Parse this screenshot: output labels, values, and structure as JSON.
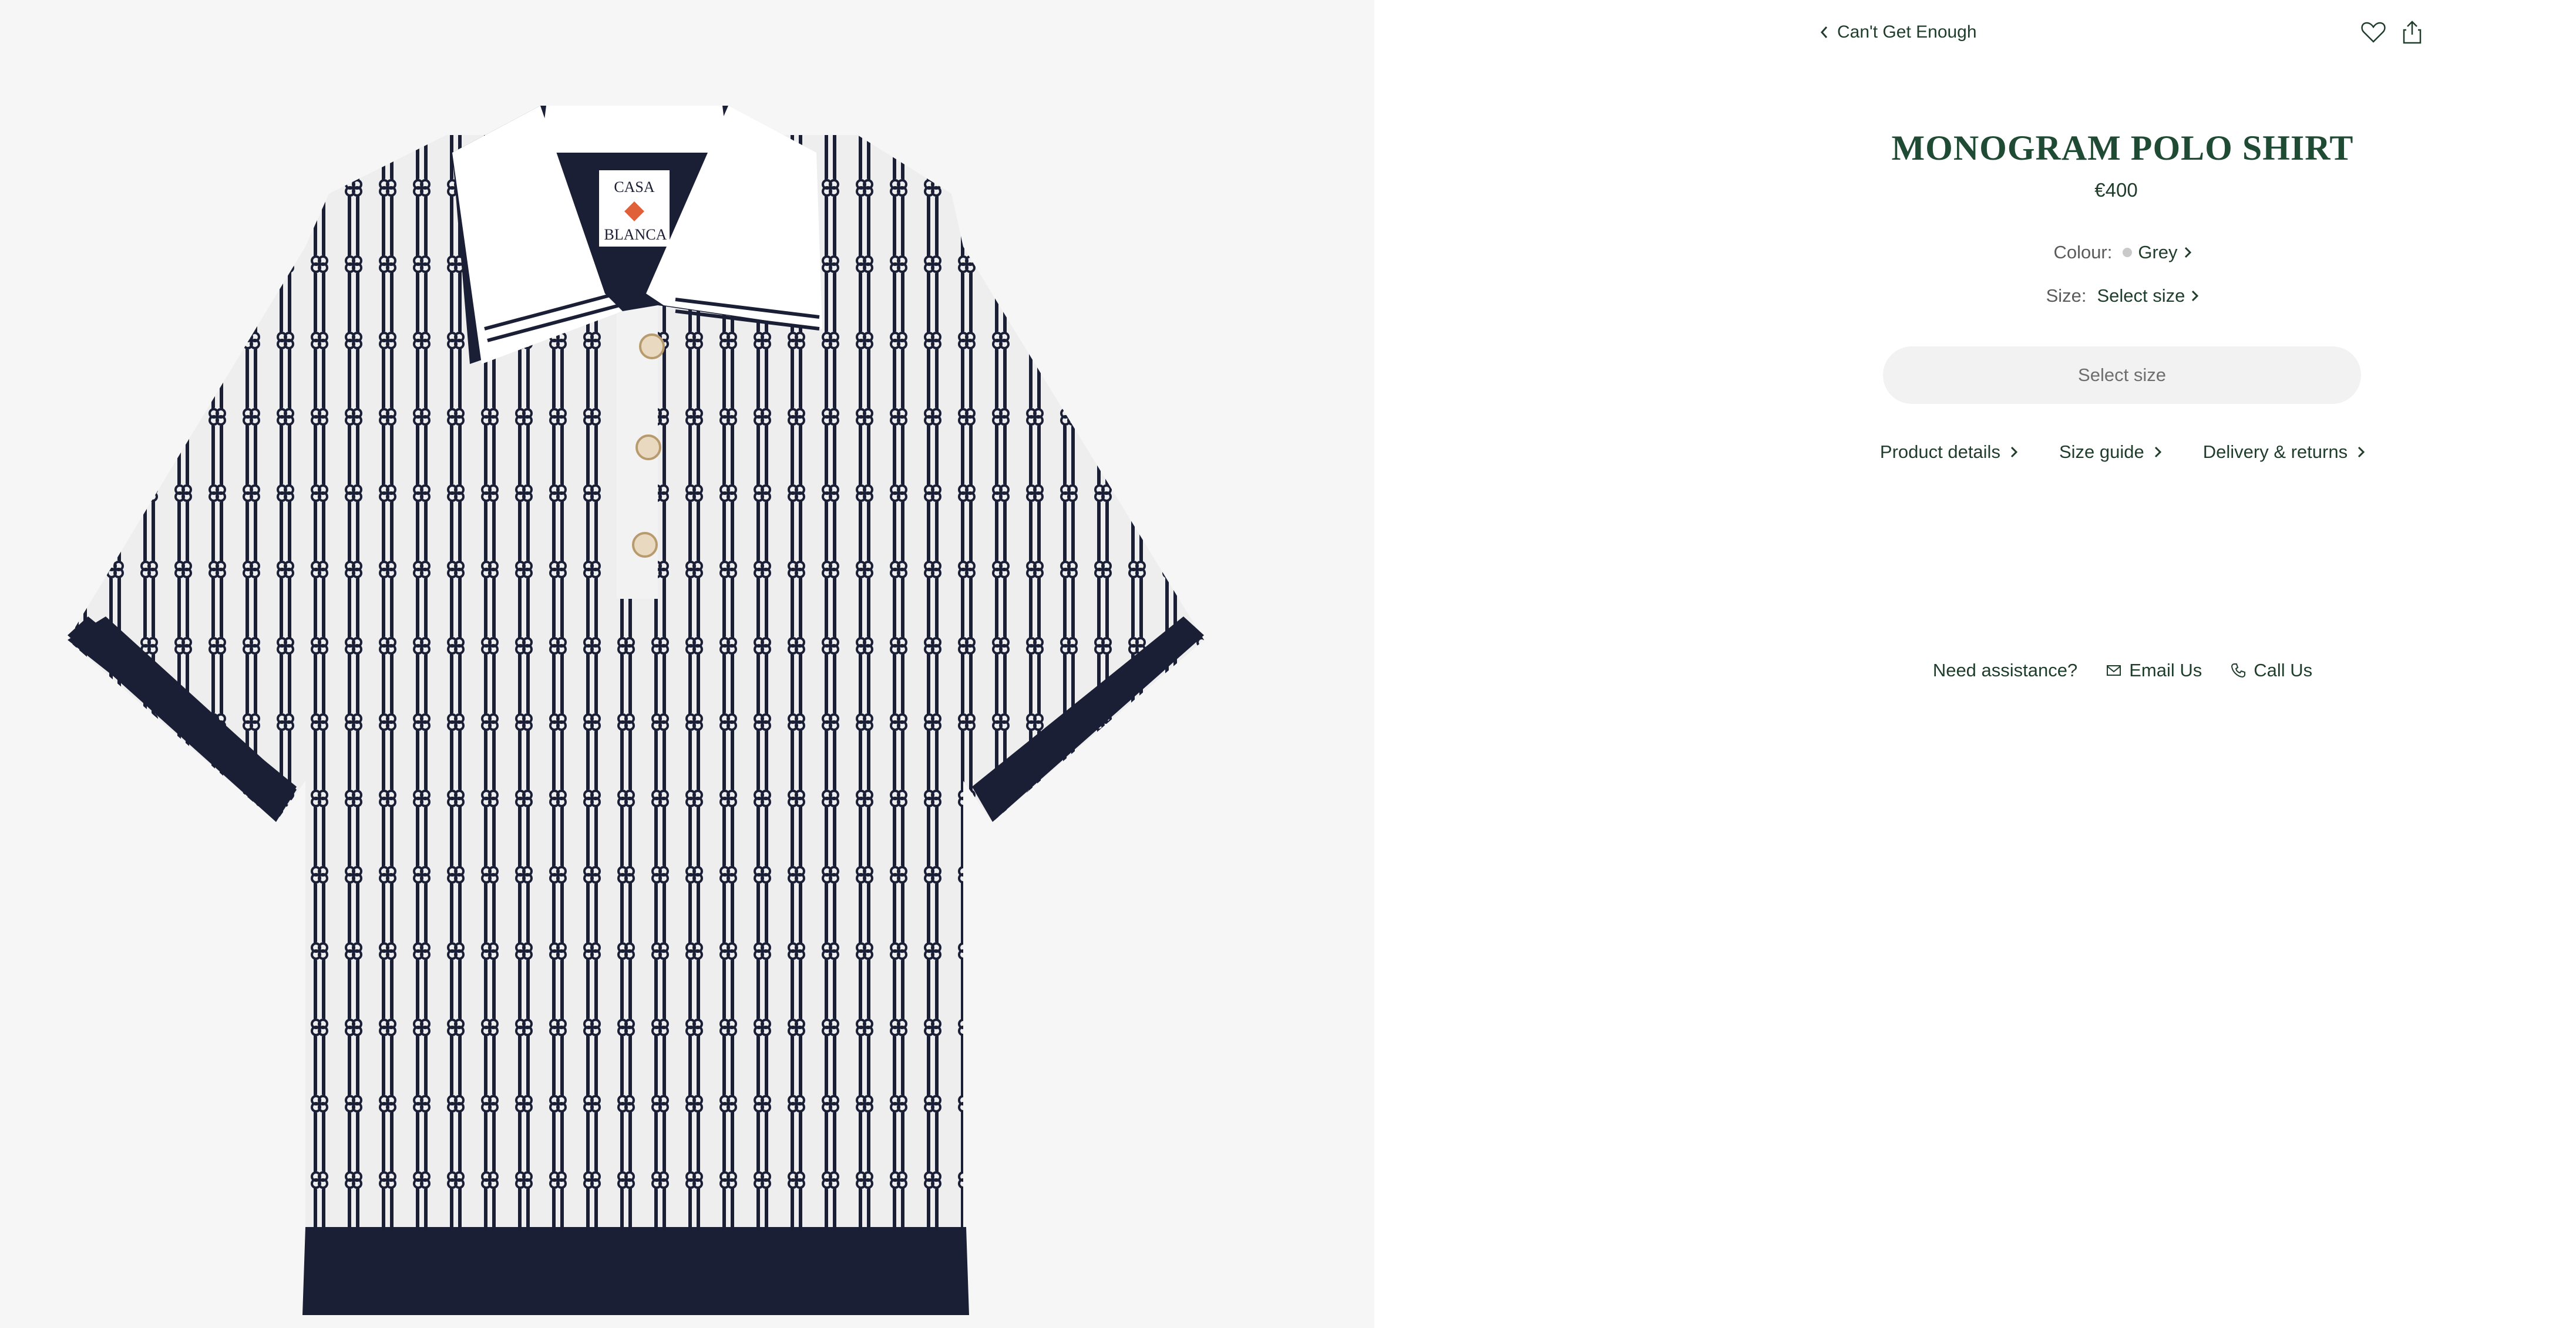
{
  "breadcrumb": {
    "back_label": "Can't Get Enough"
  },
  "product": {
    "title": "MONOGRAM POLO SHIRT",
    "price": "€400",
    "colour_label": "Colour:",
    "colour_value": "Grey",
    "colour_swatch": "#c9c9c9",
    "size_label": "Size:",
    "size_value": "Select size",
    "cta_label": "Select size",
    "image_logo_text": [
      "CASA",
      "BLANCA"
    ]
  },
  "links": {
    "product_details": "Product details",
    "size_guide": "Size guide",
    "delivery_returns": "Delivery & returns"
  },
  "assistance": {
    "label": "Need assistance?",
    "email": "Email Us",
    "call": "Call Us"
  },
  "icons": {
    "wishlist": "heart-icon",
    "share": "share-icon",
    "back": "chevron-left-icon",
    "email": "mail-icon",
    "call": "phone-icon"
  },
  "colors": {
    "brand_green": "#1f4a33",
    "text": "#1f3d2b",
    "button_bg": "#f2f2f2",
    "image_bg": "#f6f6f6",
    "shirt_navy": "#1b1f36"
  }
}
